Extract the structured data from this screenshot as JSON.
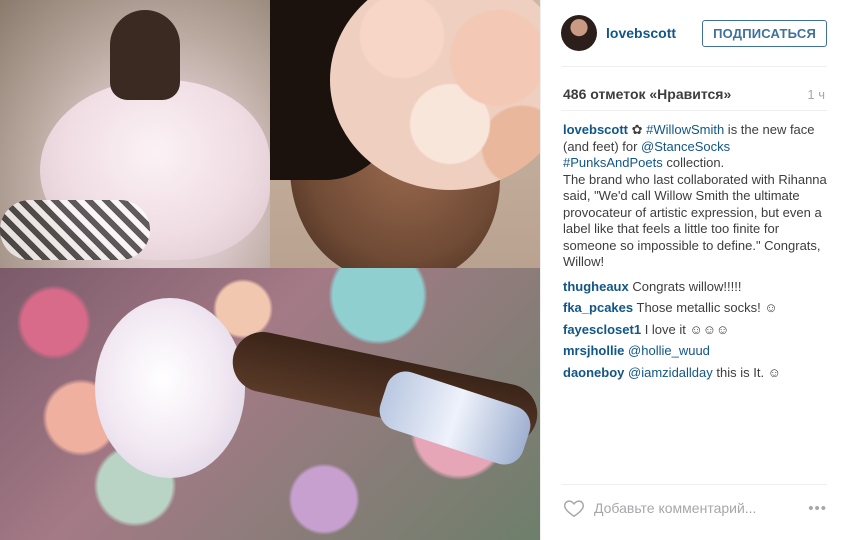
{
  "post": {
    "username": "lovebscott",
    "follow_label": "ПОДПИСАТЬСЯ",
    "likes": "486 отметок «Нравится»",
    "time": "1 ч"
  },
  "caption": {
    "user": "lovebscott",
    "emoji": "✿",
    "tag1": "#WillowSmith",
    "t1": " is the new face (and feet) for ",
    "mention": "@StanceSocks",
    "tag2": "#PunksAndPoets",
    "t2": " collection.",
    "t3": "The brand who last collaborated with Rihanna said, \"We'd call Willow Smith the ultimate provocateur of artistic expression, but even a label like that feels a little too finite for someone so impossible to define.\" Congrats, Willow!"
  },
  "comments": [
    {
      "user": "thugheaux",
      "text": "Congrats willow!!!!!"
    },
    {
      "user": "fka_pcakes",
      "text": "Those metallic socks! ☺"
    },
    {
      "user": "fayescloset1",
      "text": "I love it ☺☺☺"
    },
    {
      "user": "mrsjhollie",
      "mention": "@hollie_wuud",
      "text": ""
    },
    {
      "user": "daoneboy",
      "mention": "@iamzidallday",
      "text": " this is It. ☺"
    }
  ],
  "add_comment": {
    "placeholder": "Добавьте комментарий...",
    "more": "•••"
  },
  "colors": {
    "link": "#125688",
    "follow": "#3f729b",
    "muted": "#a5a7aa"
  }
}
